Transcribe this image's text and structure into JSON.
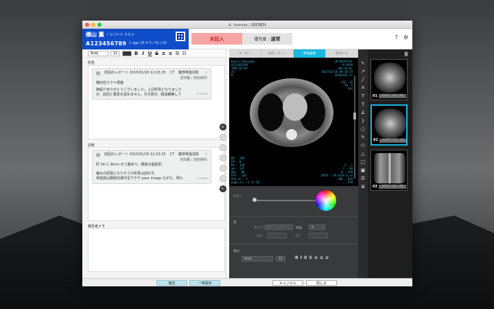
{
  "window": {
    "title": "A. Yoshida / 放射線科"
  },
  "patient": {
    "name": "横山 薫",
    "kana": "/ ヨコヤマ カオル",
    "id": "A123456789",
    "age_label": "age",
    "age": "25",
    "dob": "H 3 / 01 / 02"
  },
  "status": {
    "label": "未記入"
  },
  "priority": {
    "label": "優先度 :",
    "value": "通常"
  },
  "toolbar": {
    "help": "?",
    "settings": "⚙"
  },
  "format": {
    "font": "Arial",
    "size": "12",
    "bold": "B",
    "italic": "I",
    "underline": "U",
    "strike": "S"
  },
  "findings": {
    "label": "所見",
    "card": {
      "header": "前回のレポート 2015/01/20 12:23:25",
      "modality": "CT",
      "region": "腹部骨盤造影",
      "dept": "吉田薫 / 放射線科",
      "lines": [
        "陳旧性ラクナ梗塞",
        "御紹介ありがとうございました。上記所見となりました",
        "が、前回と著変を認めません。引き続き、経過観察して"
      ],
      "more": "▾ more"
    }
  },
  "diagnosis": {
    "label": "診断",
    "card": {
      "header": "前回のレポート 2015/01/20 12:23:25",
      "modality": "CT",
      "region": "腹部骨盤造影",
      "dept": "吉田薫 / 放射線科",
      "lines": [
        "肝 S4 に 8mm のう胞あり。軽度の脂肪肝。",
        "",
        "偏みの原因となりそうな所見は認めず。",
        "骨盤部は膀胱充満不足でやや poor image ながら、明ら"
      ],
      "more": "▾ more"
    }
  },
  "memo": {
    "label": "報告者メモ"
  },
  "bottom": {
    "confirm": "確定",
    "save_temp": "一時保存",
    "cancel": "キャンセル",
    "close": "閉じる"
  },
  "tabs": [
    {
      "label": "オーダー"
    },
    {
      "label": "過去レポート"
    },
    {
      "label": "参照画像"
    },
    {
      "label": "患者メモ"
    }
  ],
  "viewer": {
    "tl": [
      "Kaoru Yokoyama",
      "A123456789",
      "1991/01/02",
      "25",
      "M"
    ],
    "tr": [
      "LM HOSPITAL",
      "M HYOH",
      "Xbd Axial",
      "2015/02/26 09:28:34",
      "44403441.21",
      "",
      "LOC:  16",
      "TH:  5",
      "FPS"
    ],
    "bl": [
      "RD : 390",
      "FH : 0",
      "KV : 120",
      "mA : 147",
      "mAs : 88",
      "EFS : 120",
      "Acq no : 1",
      "page no : 1 of 36"
    ],
    "br": [
      "Z : 1",
      "C : 40",
      "W : 350",
      "DFOV : 39.0×39.0 cm",
      "LNG : 0×0",
      "STM"
    ]
  },
  "props": {
    "color_label": "カラー",
    "line_label": "線",
    "type_label": "タイプ",
    "width_label": "線幅",
    "width_value": "1",
    "start_label": "開始",
    "end_label": "終了",
    "text_label": "書体",
    "font": "Arial",
    "size": "12"
  },
  "thumbnails": [
    {
      "num": "01",
      "date": "2015 / 02 / 26"
    },
    {
      "num": "02",
      "date": "2015 / 02 / 26"
    },
    {
      "num": "03",
      "date": "2015 / 02 / 26"
    }
  ],
  "colors": {
    "status_bg": "#f7a5a5",
    "patient_bg": "#0f4cc9",
    "tab_active": "#18b8e0"
  }
}
